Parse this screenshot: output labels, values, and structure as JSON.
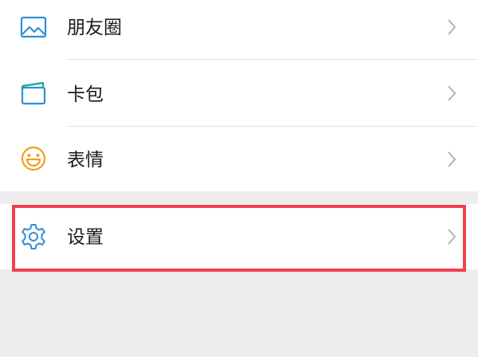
{
  "menu": {
    "items": [
      {
        "label": "朋友圈",
        "icon": "moments-image-icon"
      },
      {
        "label": "卡包",
        "icon": "card-wallet-icon"
      },
      {
        "label": "表情",
        "icon": "smiley-face-icon"
      }
    ],
    "settings": {
      "label": "设置",
      "icon": "gear-icon"
    }
  },
  "colors": {
    "icon_blue": "#2f8fd6",
    "icon_teal": "#1aa58c",
    "icon_orange": "#f0a020",
    "highlight_red": "#f0414b",
    "chevron": "#b2b2b2"
  }
}
